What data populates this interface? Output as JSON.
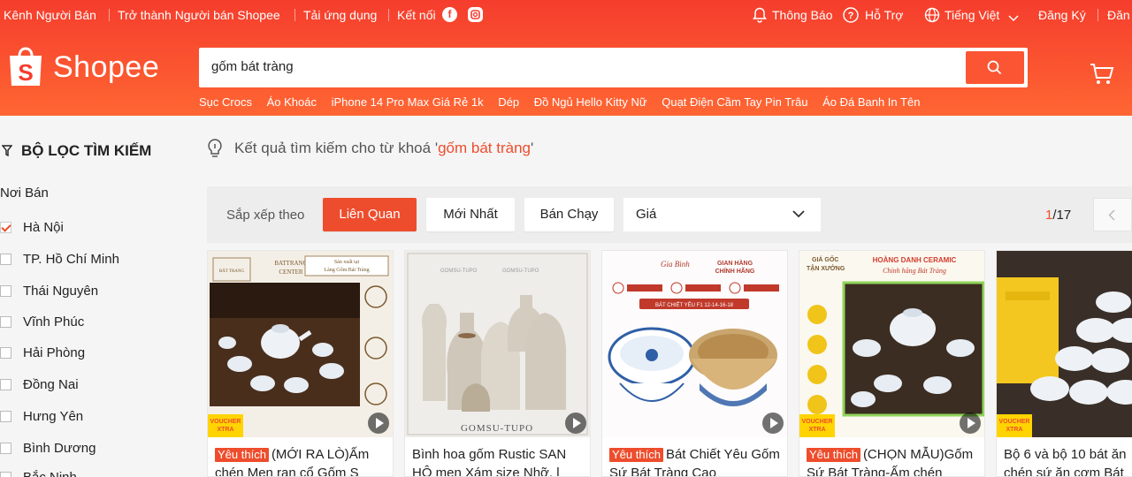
{
  "topbar": {
    "seller_channel": "Kênh Người Bán",
    "become_seller": "Trở thành Người bán Shopee",
    "download_app": "Tải ứng dụng",
    "connect": "Kết nối",
    "notifications": "Thông Báo",
    "support": "Hỗ Trợ",
    "language": "Tiếng Việt",
    "register": "Đăng Ký",
    "login_partial": "Đăn"
  },
  "brand": {
    "logo_text": "Shopee",
    "color": "#ee4d2d"
  },
  "search": {
    "query": "gốm bát tràng",
    "hints": [
      "Sục Crocs",
      "Áo Khoác",
      "iPhone 14 Pro Max Giá Rẻ 1k",
      "Dép",
      "Đồ Ngủ Hello Kitty Nữ",
      "Quạt Điện Cầm Tay Pin Trâu",
      "Áo Đá Banh In Tên"
    ]
  },
  "filters": {
    "title": "BỘ LỌC TÌM KIẾM",
    "location_title": "Nơi Bán",
    "locations": [
      {
        "label": "Hà Nội",
        "checked": true
      },
      {
        "label": "TP. Hồ Chí Minh",
        "checked": false
      },
      {
        "label": "Thái Nguyên",
        "checked": false
      },
      {
        "label": "Vĩnh Phúc",
        "checked": false
      },
      {
        "label": "Hải Phòng",
        "checked": false
      },
      {
        "label": "Đồng Nai",
        "checked": false
      },
      {
        "label": "Hưng Yên",
        "checked": false
      },
      {
        "label": "Bình Dương",
        "checked": false
      },
      {
        "label": "Bắc Ninh",
        "checked": false
      }
    ]
  },
  "results": {
    "prefix": "Kết quả tìm kiếm cho từ khoá '",
    "keyword": "gốm bát tràng",
    "suffix": "'"
  },
  "sort": {
    "label": "Sắp xếp theo",
    "options": [
      "Liên Quan",
      "Mới Nhất",
      "Bán Chạy"
    ],
    "active": "Liên Quan",
    "price_label": "Giá",
    "page_current": "1",
    "page_total": "/17"
  },
  "products": [
    {
      "badge": "Yêu thích",
      "name": "(MỚI RA LÒ)Ấm chén Men rạn cổ Gốm S",
      "voucher": "VOUCHER XTRA",
      "img_text": [
        "BATTRANG CENTER",
        "Sản xuất tại Làng Gốm Bát Tràng"
      ]
    },
    {
      "badge": "",
      "name": "Bình hoa gốm Rustic SAN HÔ men Xám size Nhỡ, l",
      "voucher": "",
      "img_text": [
        "GOMSU-TUPO"
      ]
    },
    {
      "badge": "Yêu thích",
      "name": "Bát Chiết Yêu Gốm Sứ Bát Tràng Cao",
      "voucher": "",
      "img_text": [
        "GIAN HÀNG CHÍNH HÃNG",
        "BÁT CHIẾT YÊU F1 12-14-16-18"
      ]
    },
    {
      "badge": "Yêu thích",
      "name": "(CHỌN MẪU)Gốm Sứ Bát Tràng-Ấm chén",
      "voucher": "VOUCHER XTRA",
      "img_text": [
        "GIÁ GỐC TẬN XƯỞNG",
        "Chính hãng Bát Tràng"
      ]
    },
    {
      "badge": "",
      "name": "Bộ 6 và bộ 10 bát ăn chén sứ ăn cơm Bát",
      "voucher": "VOUCHER XTRA",
      "img_text": []
    }
  ]
}
